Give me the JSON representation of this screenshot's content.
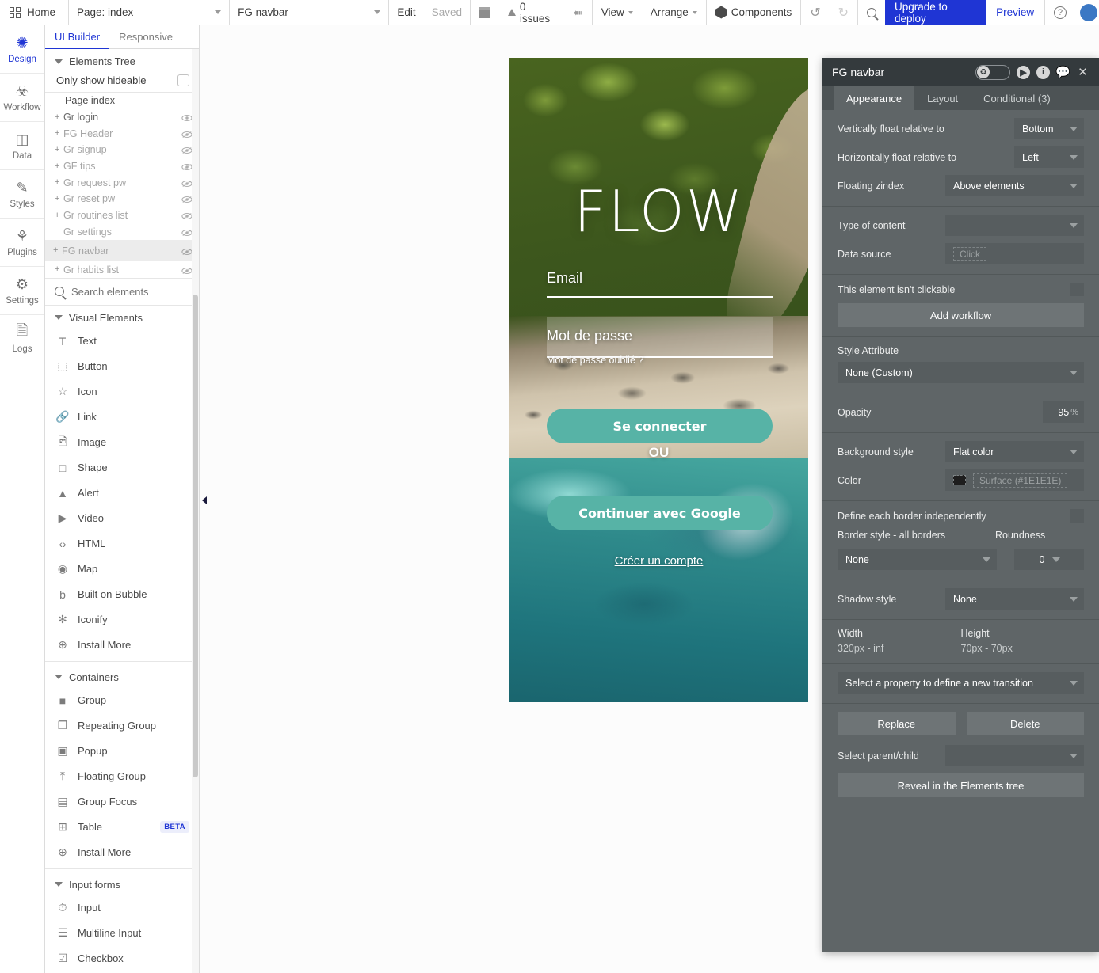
{
  "topbar": {
    "home": "Home",
    "page_select": "Page: index",
    "element_select": "FG navbar",
    "edit": "Edit",
    "saved": "Saved",
    "issues": "0 issues",
    "view": "View",
    "arrange": "Arrange",
    "components": "Components",
    "deploy": "Upgrade to deploy",
    "preview": "Preview"
  },
  "rail": {
    "items": [
      {
        "label": "Design",
        "icon": "design-tools-icon"
      },
      {
        "label": "Workflow",
        "icon": "workflow-nodes-icon"
      },
      {
        "label": "Data",
        "icon": "database-icon"
      },
      {
        "label": "Styles",
        "icon": "paintbrush-icon"
      },
      {
        "label": "Plugins",
        "icon": "plug-icon"
      },
      {
        "label": "Settings",
        "icon": "gear-icon"
      },
      {
        "label": "Logs",
        "icon": "document-icon"
      }
    ]
  },
  "left_panel": {
    "tabs": [
      {
        "label": "UI Builder",
        "active": true
      },
      {
        "label": "Responsive",
        "active": false
      }
    ],
    "elements_tree_title": "Elements Tree",
    "only_show_hideable": "Only show hideable",
    "tree": [
      {
        "label": "Page index",
        "root": true,
        "has_plus": false,
        "eye": false,
        "selected": false,
        "dim": false
      },
      {
        "label": "Gr login",
        "root": false,
        "has_plus": true,
        "eye": true,
        "selected": false,
        "dim": false
      },
      {
        "label": "FG Header",
        "root": false,
        "has_plus": true,
        "eye": true,
        "selected": false,
        "dim": true
      },
      {
        "label": "Gr signup",
        "root": false,
        "has_plus": true,
        "eye": true,
        "selected": false,
        "dim": true
      },
      {
        "label": "GF tips",
        "root": false,
        "has_plus": true,
        "eye": true,
        "selected": false,
        "dim": true
      },
      {
        "label": "Gr request pw",
        "root": false,
        "has_plus": true,
        "eye": true,
        "selected": false,
        "dim": true
      },
      {
        "label": "Gr reset pw",
        "root": false,
        "has_plus": true,
        "eye": true,
        "selected": false,
        "dim": true
      },
      {
        "label": "Gr routines list",
        "root": false,
        "has_plus": true,
        "eye": true,
        "selected": false,
        "dim": true
      },
      {
        "label": "Gr settings",
        "root": false,
        "has_plus": false,
        "eye": true,
        "selected": false,
        "dim": true
      },
      {
        "label": "FG navbar",
        "root": false,
        "has_plus": true,
        "eye": true,
        "selected": true,
        "dim": true
      },
      {
        "label": "Gr habits list",
        "root": false,
        "has_plus": true,
        "eye": true,
        "selected": false,
        "dim": true
      }
    ],
    "search_placeholder": "Search elements",
    "groups": [
      {
        "title": "Visual Elements",
        "items": [
          {
            "label": "Text",
            "icon": "text-icon",
            "badge": ""
          },
          {
            "label": "Button",
            "icon": "button-icon",
            "badge": ""
          },
          {
            "label": "Icon",
            "icon": "star-icon",
            "badge": ""
          },
          {
            "label": "Link",
            "icon": "link-icon",
            "badge": ""
          },
          {
            "label": "Image",
            "icon": "image-icon",
            "badge": ""
          },
          {
            "label": "Shape",
            "icon": "square-icon",
            "badge": ""
          },
          {
            "label": "Alert",
            "icon": "alert-triangle-icon",
            "badge": ""
          },
          {
            "label": "Video",
            "icon": "video-play-icon",
            "badge": ""
          },
          {
            "label": "HTML",
            "icon": "code-icon",
            "badge": ""
          },
          {
            "label": "Map",
            "icon": "map-pin-icon",
            "badge": ""
          },
          {
            "label": "Built on Bubble",
            "icon": "bubble-b-icon",
            "badge": ""
          },
          {
            "label": "Iconify",
            "icon": "iconify-asterisk-icon",
            "badge": ""
          },
          {
            "label": "Install More",
            "icon": "plus-circle-icon",
            "badge": ""
          }
        ]
      },
      {
        "title": "Containers",
        "items": [
          {
            "label": "Group",
            "icon": "group-square-icon",
            "badge": ""
          },
          {
            "label": "Repeating Group",
            "icon": "repeating-group-icon",
            "badge": ""
          },
          {
            "label": "Popup",
            "icon": "popup-icon",
            "badge": ""
          },
          {
            "label": "Floating Group",
            "icon": "floating-group-icon",
            "badge": ""
          },
          {
            "label": "Group Focus",
            "icon": "group-focus-icon",
            "badge": ""
          },
          {
            "label": "Table",
            "icon": "table-grid-icon",
            "badge": "BETA"
          },
          {
            "label": "Install More",
            "icon": "plus-circle-icon",
            "badge": ""
          }
        ]
      },
      {
        "title": "Input forms",
        "items": [
          {
            "label": "Input",
            "icon": "input-field-icon",
            "badge": ""
          },
          {
            "label": "Multiline Input",
            "icon": "multiline-input-icon",
            "badge": ""
          },
          {
            "label": "Checkbox",
            "icon": "checkbox-icon",
            "badge": ""
          }
        ]
      }
    ]
  },
  "canvas": {
    "app": {
      "logo": "FLOW",
      "email_label": "Email",
      "password_label": "Mot de passe",
      "forgot_password": "Mot de passe oublié ?",
      "login_button": "Se connecter",
      "or": "OU",
      "google_button": "Continuer avec Google",
      "create_account": "Créer un compte",
      "accent_color": "#57B3A6"
    }
  },
  "properties": {
    "title": "FG navbar",
    "tabs": [
      {
        "label": "Appearance",
        "active": true
      },
      {
        "label": "Layout",
        "active": false
      },
      {
        "label": "Conditional (3)",
        "active": false
      }
    ],
    "float": {
      "vertical_label": "Vertically float relative to",
      "vertical_value": "Bottom",
      "horizontal_label": "Horizontally float relative to",
      "horizontal_value": "Left",
      "zindex_label": "Floating zindex",
      "zindex_value": "Above elements"
    },
    "content": {
      "type_label": "Type of content",
      "type_value": "",
      "datasource_label": "Data source",
      "datasource_value": "Click"
    },
    "clickable": {
      "label": "This element isn't clickable",
      "add_workflow": "Add workflow"
    },
    "style": {
      "attribute_label": "Style Attribute",
      "attribute_value": "None (Custom)",
      "opacity_label": "Opacity",
      "opacity_value": "95",
      "opacity_unit": "%",
      "background_label": "Background style",
      "background_value": "Flat color",
      "color_label": "Color",
      "color_value": "Surface (#1E1E1E)",
      "color_hex": "#1E1E1E"
    },
    "border": {
      "define_each_label": "Define each border independently",
      "style_label": "Border style - all borders",
      "style_value": "None",
      "roundness_label": "Roundness",
      "roundness_value": "0"
    },
    "shadow": {
      "label": "Shadow style",
      "value": "None"
    },
    "dimensions": {
      "width_label": "Width",
      "width_value": "320px - inf",
      "height_label": "Height",
      "height_value": "70px - 70px"
    },
    "transition": {
      "value": "Select a property to define a new transition"
    },
    "actions": {
      "replace": "Replace",
      "delete": "Delete",
      "parent_child_label": "Select parent/child",
      "parent_child_value": "",
      "reveal": "Reveal in the Elements tree"
    }
  }
}
